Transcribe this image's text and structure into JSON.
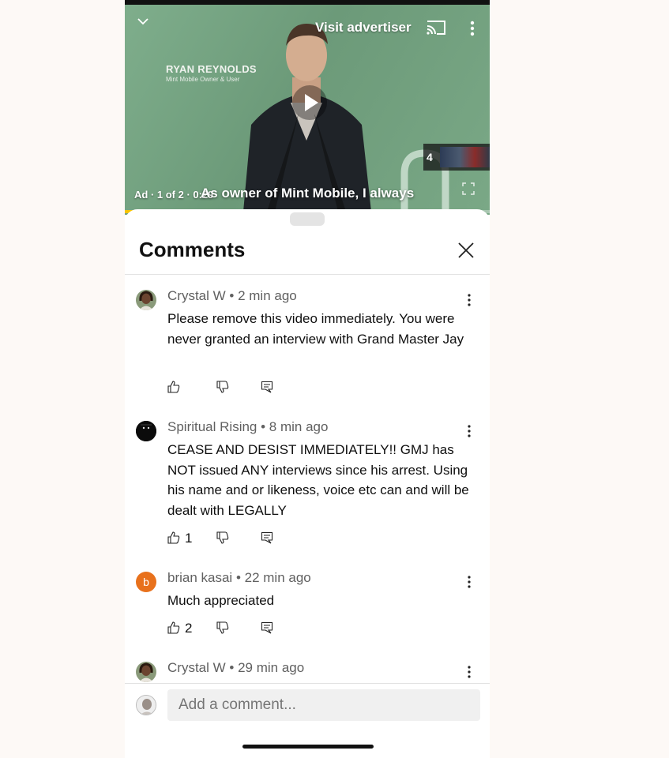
{
  "video": {
    "brand_title": "RYAN REYNOLDS",
    "brand_subtitle": "Mint Mobile Owner & User",
    "visit_advertiser": "Visit advertiser",
    "ad_info": "Ad · 1 of 2 · 0:29",
    "caption": "As owner of Mint Mobile, I always",
    "queue_count": "4",
    "progress_percent": 4,
    "colors": {
      "background": "#7aa886",
      "progress": "#f5c400"
    }
  },
  "comments_sheet": {
    "title": "Comments",
    "comments": [
      {
        "author": "Crystal W",
        "time": "2 min ago",
        "text": "Please remove this video immediately.  You were never granted an interview with Grand Master Jay",
        "likes": "",
        "avatar": "photo-avatar"
      },
      {
        "author": "Spiritual Rising",
        "time": "8 min ago",
        "text": "CEASE AND DESIST IMMEDIATELY!! GMJ has NOT issued ANY interviews since his arrest. Using his name and or likeness, voice etc can and will be dealt with LEGALLY",
        "likes": "1",
        "avatar": "dark-avatar"
      },
      {
        "author": "brian kasai",
        "time": "22 min ago",
        "text": "Much appreciated",
        "likes": "2",
        "avatar": "b",
        "avatar_color": "#e8711c"
      },
      {
        "author": "Crystal W",
        "time": "29 min ago",
        "text": "",
        "likes": "",
        "avatar": "photo-avatar"
      }
    ],
    "input_placeholder": "Add a comment..."
  }
}
